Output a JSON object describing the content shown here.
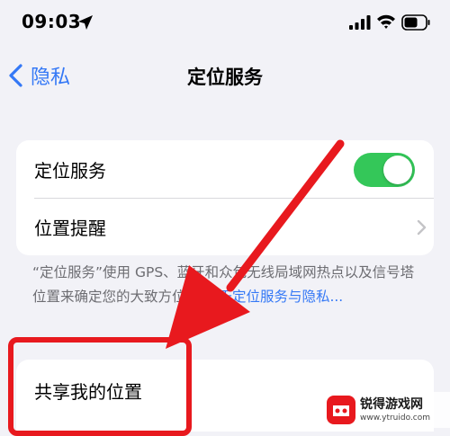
{
  "status_bar": {
    "time": "09:03",
    "icons": [
      "location-arrow-icon",
      "cellular-signal-icon",
      "wifi-icon",
      "battery-icon"
    ]
  },
  "nav": {
    "back_label": "隐私",
    "title": "定位服务"
  },
  "settings": {
    "items": [
      {
        "label": "定位服务",
        "control": "toggle",
        "toggle_on": true
      },
      {
        "label": "位置提醒",
        "control": "chevron"
      }
    ],
    "footer_text": "“定位服务”使用 GPS、蓝牙和众包无线局域网热点以及信号塔位置来确定您的大致方位。",
    "footer_link": "关于定位服务与隐私..."
  },
  "share": {
    "label": "共享我的位置"
  },
  "watermark": {
    "name": "锐得游戏网",
    "url": "www.ytruido.com"
  },
  "colors": {
    "accent": "#3478f6",
    "toggle_on": "#34c759",
    "annotation_red": "#e8191e",
    "background": "#f2f2f7"
  }
}
